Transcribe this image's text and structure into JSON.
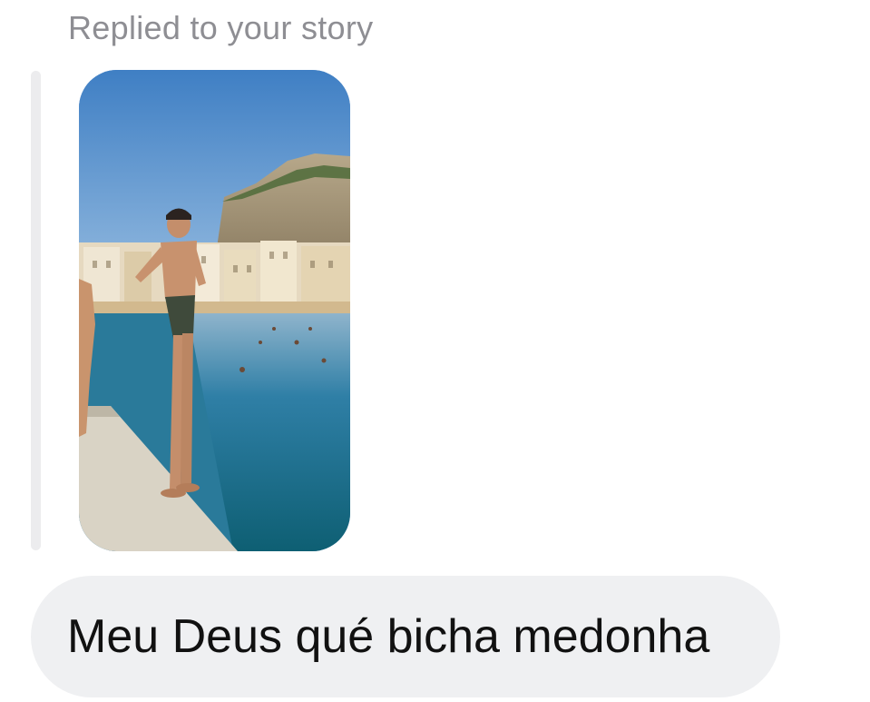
{
  "reply": {
    "header": "Replied to your story"
  },
  "story": {
    "image_label": "story-photo"
  },
  "message": {
    "text": "Meu Deus qué bicha medonha"
  },
  "colors": {
    "header_text": "#8e8e93",
    "bubble_background": "#eff0f2",
    "message_text": "#111111",
    "reply_bar": "#ececee"
  }
}
